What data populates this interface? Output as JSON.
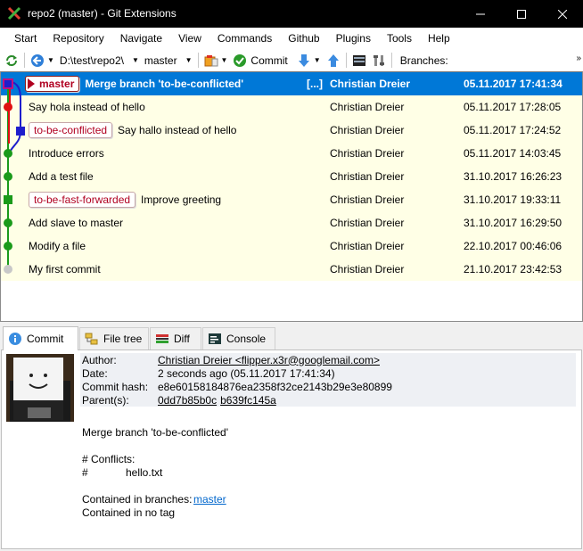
{
  "window": {
    "title": "repo2 (master) - Git Extensions",
    "minimize_glyph": "—",
    "maximize_glyph": "☐",
    "close_glyph": "✕"
  },
  "menu": [
    "Start",
    "Repository",
    "Navigate",
    "View",
    "Commands",
    "Github",
    "Plugins",
    "Tools",
    "Help"
  ],
  "toolbar": {
    "path": "D:\\test\\repo2\\",
    "branch": "master",
    "commit_label": "Commit",
    "branches_label": "Branches:",
    "branches_value": "",
    "overflow": "»"
  },
  "revisions": [
    {
      "refs": [
        {
          "label": "master",
          "head": true
        }
      ],
      "message": "Merge branch 'to-be-conflicted'",
      "more": "[...]",
      "author": "Christian Dreier",
      "date": "05.11.2017 17:41:34",
      "selected": true
    },
    {
      "refs": [],
      "message": "Say hola instead of hello",
      "author": "Christian Dreier",
      "date": "05.11.2017 17:28:05"
    },
    {
      "refs": [
        {
          "label": "to-be-conflicted"
        }
      ],
      "message": "Say hallo instead of hello",
      "author": "Christian Dreier",
      "date": "05.11.2017 17:24:52"
    },
    {
      "refs": [],
      "message": "Introduce errors",
      "author": "Christian Dreier",
      "date": "05.11.2017 14:03:45"
    },
    {
      "refs": [],
      "message": "Add a test file",
      "author": "Christian Dreier",
      "date": "31.10.2017 16:26:23"
    },
    {
      "refs": [
        {
          "label": "to-be-fast-forwarded"
        }
      ],
      "message": "Improve greeting",
      "author": "Christian Dreier",
      "date": "31.10.2017 19:33:11"
    },
    {
      "refs": [],
      "message": "Add slave to master",
      "author": "Christian Dreier",
      "date": "31.10.2017 16:29:50"
    },
    {
      "refs": [],
      "message": "Modify a file",
      "author": "Christian Dreier",
      "date": "22.10.2017 00:46:06"
    },
    {
      "refs": [],
      "message": "My first commit",
      "author": "Christian Dreier",
      "date": "21.10.2017 23:42:53"
    }
  ],
  "tabs": [
    "Commit",
    "File tree",
    "Diff",
    "Console"
  ],
  "commit": {
    "author_key": "Author:",
    "author": "Christian Dreier <flipper.x3r@googlemail.com>",
    "date_key": "Date:",
    "date": "2 seconds ago (05.11.2017 17:41:34)",
    "hash_key": "Commit hash:",
    "hash": "e8e60158184876ea2358f32ce2143b29e3e80899",
    "parents_key": "Parent(s):",
    "parents": [
      "0dd7b85b0c",
      "b639fc145a"
    ],
    "message_title": "Merge branch 'to-be-conflicted'",
    "conflicts_header": "# Conflicts:",
    "conflicts_line_prefix": "#",
    "conflict_file": "hello.txt",
    "contained_branches_label": "Contained in branches:",
    "contained_branch": "master",
    "contained_tags": "Contained in no tag"
  },
  "colors": {
    "selection": "#0078d7",
    "row_background": "#ffffe6",
    "ref_text": "#b00020",
    "link": "#0066cc",
    "graph_green": "#1a9a1a",
    "graph_red": "#e01010",
    "graph_blue": "#1e1ecc"
  }
}
